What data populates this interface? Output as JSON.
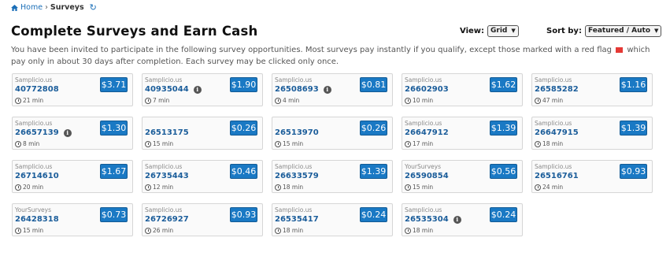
{
  "breadcrumb": {
    "home": "Home",
    "separator": "›",
    "current": "Surveys"
  },
  "title": "Complete Surveys and Earn Cash",
  "view": {
    "label": "View:",
    "value": "Grid"
  },
  "sort": {
    "label": "Sort by:",
    "value": "Featured / Auto"
  },
  "intro": {
    "before_flag": "You have been invited to participate in the following survey opportunities. Most surveys pay instantly if you qualify, except those marked with a red flag",
    "after_flag": "which pay only in about 30 days after completion. Each survey may be clicked only once."
  },
  "colors": {
    "accent": "#1a79c4",
    "link": "#1b6fb8",
    "flag": "#e53935"
  },
  "icons": {
    "home": "home-icon",
    "refresh": "refresh-icon",
    "info": "info-icon",
    "clock": "clock-icon",
    "flag": "red-flag-icon"
  },
  "surveys": [
    {
      "provider": "Samplicio.us",
      "id": "40772808",
      "duration": "21 min",
      "price": "$3.71",
      "info": false
    },
    {
      "provider": "Samplicio.us",
      "id": "40935044",
      "duration": "7 min",
      "price": "$1.90",
      "info": true
    },
    {
      "provider": "Samplicio.us",
      "id": "26508693",
      "duration": "4 min",
      "price": "$0.81",
      "info": true
    },
    {
      "provider": "Samplicio.us",
      "id": "26602903",
      "duration": "10 min",
      "price": "$1.62",
      "info": false
    },
    {
      "provider": "Samplicio.us",
      "id": "26585282",
      "duration": "47 min",
      "price": "$1.16",
      "info": false
    },
    {
      "provider": "Samplicio.us",
      "id": "26657139",
      "duration": "8 min",
      "price": "$1.30",
      "info": true
    },
    {
      "provider": "",
      "id": "26513175",
      "duration": "15 min",
      "price": "$0.26",
      "info": false
    },
    {
      "provider": "",
      "id": "26513970",
      "duration": "15 min",
      "price": "$0.26",
      "info": false
    },
    {
      "provider": "Samplicio.us",
      "id": "26647912",
      "duration": "17 min",
      "price": "$1.39",
      "info": false
    },
    {
      "provider": "Samplicio.us",
      "id": "26647915",
      "duration": "18 min",
      "price": "$1.39",
      "info": false
    },
    {
      "provider": "Samplicio.us",
      "id": "26714610",
      "duration": "20 min",
      "price": "$1.67",
      "info": false
    },
    {
      "provider": "Samplicio.us",
      "id": "26735443",
      "duration": "12 min",
      "price": "$0.46",
      "info": false
    },
    {
      "provider": "Samplicio.us",
      "id": "26633579",
      "duration": "18 min",
      "price": "$1.39",
      "info": false
    },
    {
      "provider": "YourSurveys",
      "id": "26590854",
      "duration": "15 min",
      "price": "$0.56",
      "info": false
    },
    {
      "provider": "Samplicio.us",
      "id": "26516761",
      "duration": "24 min",
      "price": "$0.93",
      "info": false
    },
    {
      "provider": "YourSurveys",
      "id": "26428318",
      "duration": "15 min",
      "price": "$0.73",
      "info": false
    },
    {
      "provider": "Samplicio.us",
      "id": "26726927",
      "duration": "26 min",
      "price": "$0.93",
      "info": false
    },
    {
      "provider": "Samplicio.us",
      "id": "26535417",
      "duration": "18 min",
      "price": "$0.24",
      "info": false
    },
    {
      "provider": "Samplicio.us",
      "id": "26535304",
      "duration": "18 min",
      "price": "$0.24",
      "info": true
    }
  ]
}
